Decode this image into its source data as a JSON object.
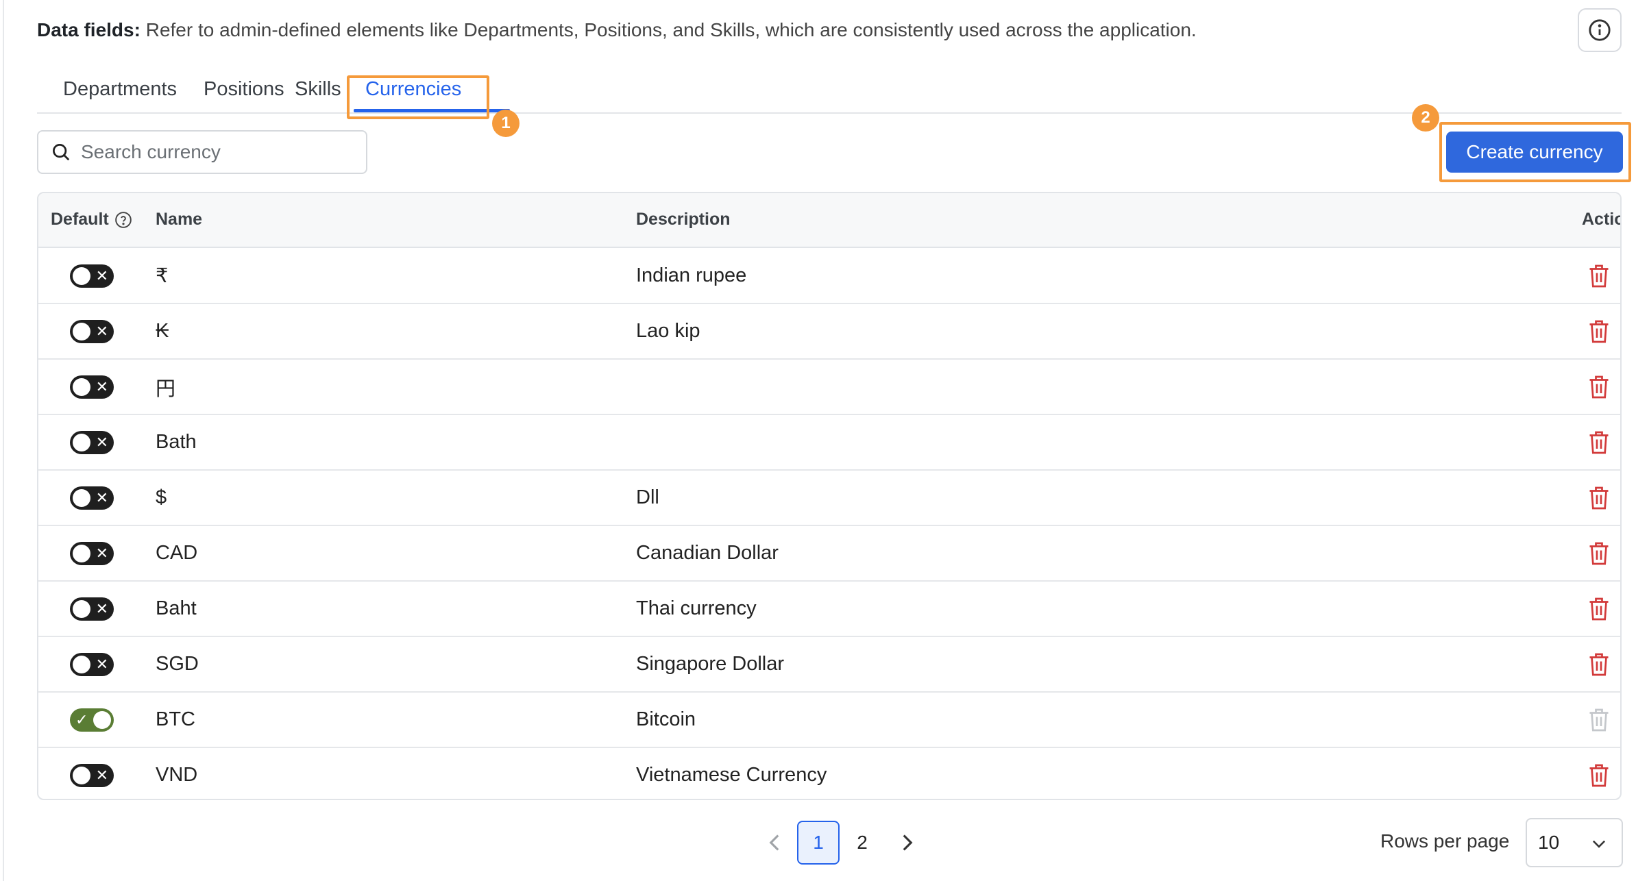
{
  "header": {
    "label": "Data fields:",
    "description": "Refer to admin-defined elements like Departments, Positions, and Skills, which are consistently used across the application."
  },
  "tabs": [
    {
      "label": "Departments",
      "active": false
    },
    {
      "label": "Positions",
      "active": false
    },
    {
      "label": "Skills",
      "active": false
    },
    {
      "label": "Currencies",
      "active": true
    }
  ],
  "annotations": {
    "marker1": "1",
    "marker2": "2",
    "color": "#f59a3b"
  },
  "search": {
    "placeholder": "Search currency",
    "value": ""
  },
  "create_button": {
    "label": "Create currency"
  },
  "table": {
    "headers": {
      "default": "Default",
      "name": "Name",
      "description": "Description",
      "action": "Action"
    },
    "rows": [
      {
        "default": false,
        "name": "₹",
        "description": "Indian rupee",
        "deletable": true
      },
      {
        "default": false,
        "name": "₭",
        "description": "Lao kip",
        "deletable": true
      },
      {
        "default": false,
        "name": "円",
        "description": "",
        "deletable": true
      },
      {
        "default": false,
        "name": "Bath",
        "description": "",
        "deletable": true
      },
      {
        "default": false,
        "name": "$",
        "description": "Dll",
        "deletable": true
      },
      {
        "default": false,
        "name": "CAD",
        "description": "Canadian Dollar",
        "deletable": true
      },
      {
        "default": false,
        "name": "Baht",
        "description": "Thai currency",
        "deletable": true
      },
      {
        "default": false,
        "name": "SGD",
        "description": "Singapore Dollar",
        "deletable": true
      },
      {
        "default": true,
        "name": "BTC",
        "description": "Bitcoin",
        "deletable": false
      },
      {
        "default": false,
        "name": "VND",
        "description": "Vietnamese Currency",
        "deletable": true
      }
    ]
  },
  "pagination": {
    "pages": [
      "1",
      "2"
    ],
    "current_page": "1"
  },
  "rows_per_page": {
    "label": "Rows per page",
    "value": "10"
  },
  "colors": {
    "accent": "#2563eb",
    "button": "#2f68dd",
    "delete": "#d23a3a",
    "toggle_on": "#5a7d34",
    "toggle_off": "#1f1f1f"
  }
}
